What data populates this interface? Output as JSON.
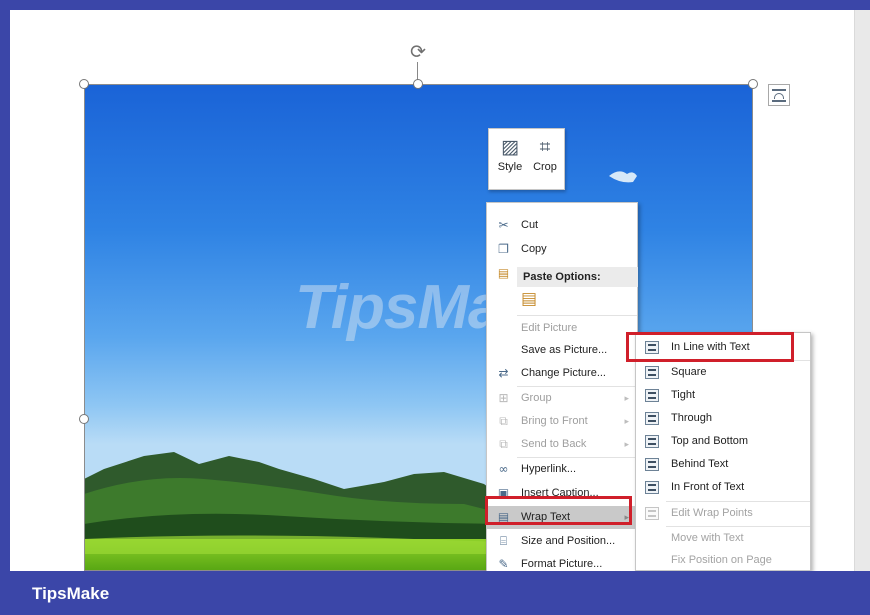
{
  "mini_toolbar": {
    "style_label": "Style",
    "crop_label": "Crop",
    "style_icon": "picture-style-icon",
    "crop_icon": "crop-icon"
  },
  "context_menu": {
    "cut": "Cut",
    "copy": "Copy",
    "paste_options": "Paste Options:",
    "edit_picture": "Edit Picture",
    "save_as_picture": "Save as Picture...",
    "change_picture": "Change Picture...",
    "group": "Group",
    "bring_to_front": "Bring to Front",
    "send_to_back": "Send to Back",
    "hyperlink": "Hyperlink...",
    "insert_caption": "Insert Caption...",
    "wrap_text": "Wrap Text",
    "size_and_position": "Size and Position...",
    "format_picture": "Format Picture..."
  },
  "wrap_submenu": {
    "in_line_with_text": "In Line with Text",
    "square": "Square",
    "tight": "Tight",
    "through": "Through",
    "top_and_bottom": "Top and Bottom",
    "behind_text": "Behind Text",
    "in_front_of_text": "In Front of Text",
    "edit_wrap_points": "Edit Wrap Points",
    "move_with_text": "Move with Text",
    "fix_position_on_page": "Fix Position on Page"
  },
  "watermark_text": "TipsMake",
  "footer": {
    "brand": "TipsMake"
  },
  "colors": {
    "accent": "#3b46a8",
    "highlight_box": "#d01f2a",
    "menu_hover": "#c9c9c9"
  }
}
